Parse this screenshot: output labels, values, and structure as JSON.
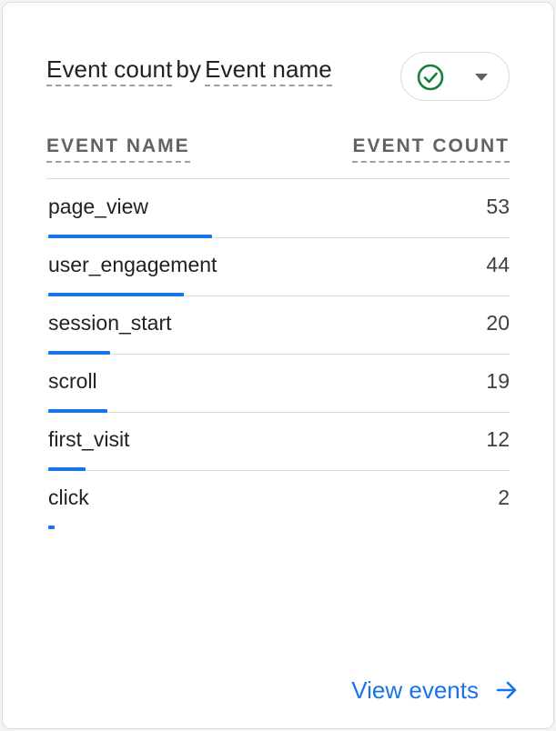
{
  "card": {
    "title_part1": "Event count",
    "title_part2": "by",
    "title_part3": "Event name",
    "picker_icon": "check-circle-icon",
    "picker_dropdown_icon": "caret-down-icon"
  },
  "table": {
    "col_name": "EVENT NAME",
    "col_count": "EVENT COUNT",
    "rows": [
      {
        "name": "page_view",
        "count": "53",
        "value": 53
      },
      {
        "name": "user_engagement",
        "count": "44",
        "value": 44
      },
      {
        "name": "session_start",
        "count": "20",
        "value": 20
      },
      {
        "name": "scroll",
        "count": "19",
        "value": 19
      },
      {
        "name": "first_visit",
        "count": "12",
        "value": 12
      },
      {
        "name": "click",
        "count": "2",
        "value": 2
      }
    ]
  },
  "footer": {
    "link_label": "View events",
    "link_icon": "arrow-right-icon"
  },
  "colors": {
    "accent": "#1a73e8",
    "success": "#188038"
  }
}
